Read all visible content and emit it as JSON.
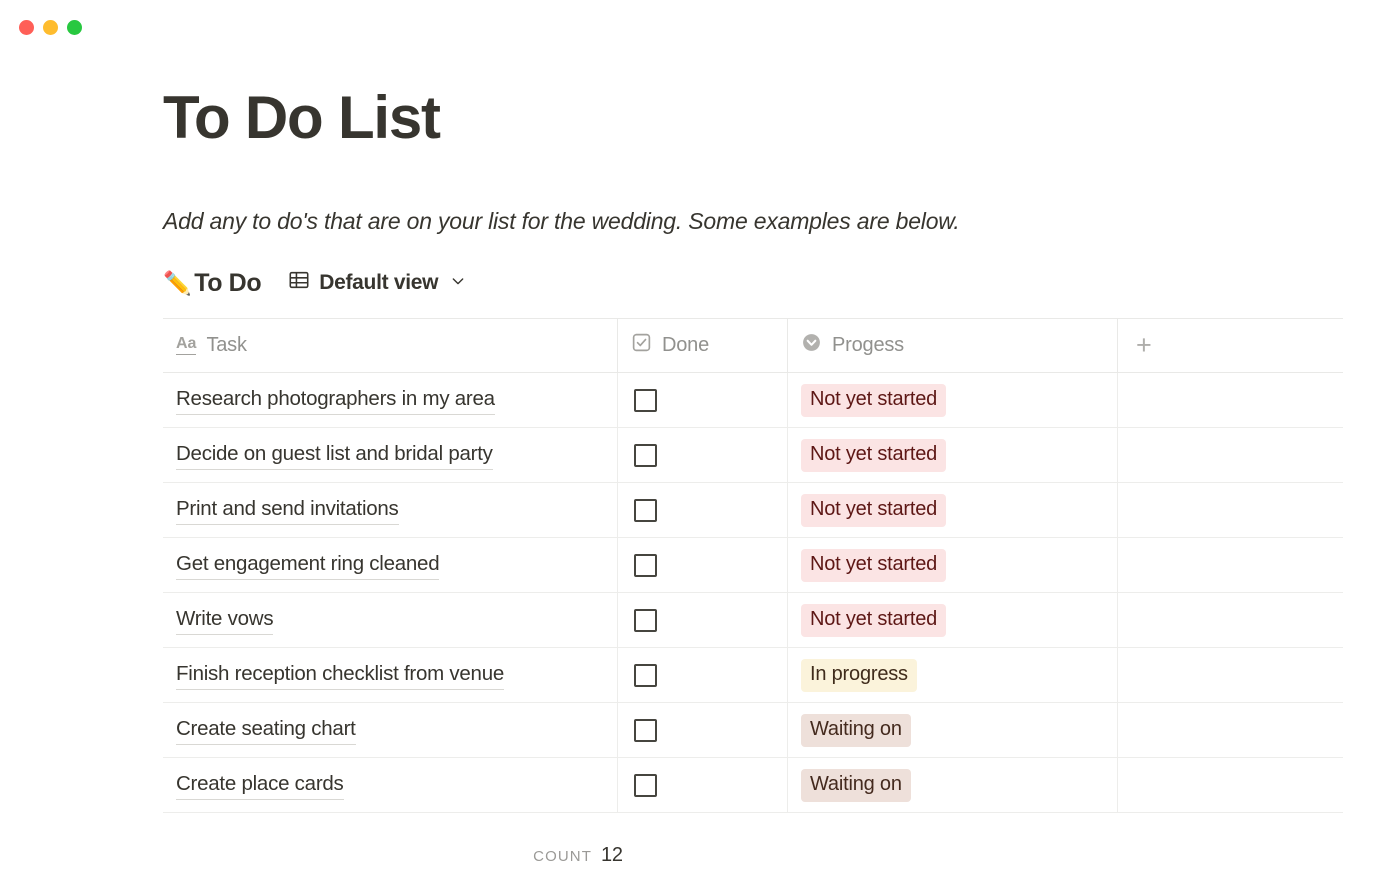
{
  "window": {
    "traffic_lights": [
      {
        "name": "close",
        "color": "#FF5F57"
      },
      {
        "name": "minimize",
        "color": "#FEBC2E"
      },
      {
        "name": "maximize",
        "color": "#28C840"
      }
    ]
  },
  "page": {
    "title": "To Do List",
    "subtitle": "Add any to do's that are on your list for the wedding. Some examples are below."
  },
  "database": {
    "emoji": "✏️",
    "name": "To Do",
    "view_label": "Default view",
    "view_icon": "table-icon",
    "chevron_icon": "chevron-down-icon",
    "add_column_icon": "plus-icon",
    "columns": [
      {
        "label": "Task",
        "icon": "text-aa-icon",
        "type": "title"
      },
      {
        "label": "Done",
        "icon": "checkbox-icon",
        "type": "checkbox"
      },
      {
        "label": "Progess",
        "icon": "select-circle-icon",
        "type": "select"
      }
    ],
    "rows": [
      {
        "task": "Research photographers in my area",
        "done": false,
        "progress": "Not yet started"
      },
      {
        "task": "Decide on guest list and bridal party",
        "done": false,
        "progress": "Not yet started"
      },
      {
        "task": "Print and send invitations",
        "done": false,
        "progress": "Not yet started"
      },
      {
        "task": "Get engagement ring cleaned",
        "done": false,
        "progress": "Not yet started"
      },
      {
        "task": "Write vows",
        "done": false,
        "progress": "Not yet started"
      },
      {
        "task": "Finish reception checklist from venue",
        "done": false,
        "progress": "In progress"
      },
      {
        "task": "Create seating chart",
        "done": false,
        "progress": "Waiting on"
      },
      {
        "task": "Create place cards",
        "done": false,
        "progress": "Waiting on"
      }
    ],
    "status_colors": {
      "Not yet started": {
        "bg": "#FBE4E4",
        "fg": "#5D1715"
      },
      "In progress": {
        "bg": "#FBF3DB",
        "fg": "#402C1B"
      },
      "Waiting on": {
        "bg": "#EEE0DA",
        "fg": "#442A1E"
      }
    },
    "footer": {
      "count_label": "COUNT",
      "count_value": "12"
    }
  }
}
